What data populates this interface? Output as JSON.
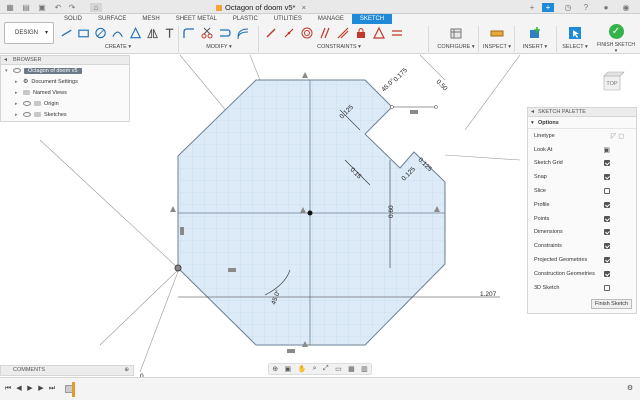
{
  "window": {
    "title": "Octagon of doom v5*"
  },
  "workspace": {
    "selector_label": "DESIGN",
    "tabs": [
      {
        "label": "SOLID"
      },
      {
        "label": "SURFACE"
      },
      {
        "label": "MESH"
      },
      {
        "label": "SHEET METAL"
      },
      {
        "label": "PLASTIC"
      },
      {
        "label": "UTILITIES"
      },
      {
        "label": "MANAGE"
      },
      {
        "label": "SKETCH",
        "active": true
      }
    ]
  },
  "toolbar_groups": {
    "create": "CREATE ▾",
    "modify": "MODIFY ▾",
    "constraints": "CONSTRAINTS ▾",
    "configure": "CONFIGURE ▾",
    "inspect": "INSPECT ▾",
    "insert": "INSERT ▾",
    "select": "SELECT ▾",
    "finish": "FINISH SKETCH ▾"
  },
  "browser": {
    "title": "BROWSER",
    "items": [
      {
        "label": "Octagon of doom v5"
      },
      {
        "label": "Document Settings"
      },
      {
        "label": "Named Views"
      },
      {
        "label": "Origin"
      },
      {
        "label": "Sketches"
      }
    ]
  },
  "sketch_palette": {
    "title": "SKETCH PALETTE",
    "section": "Options",
    "rows": [
      {
        "label": "Linetype"
      },
      {
        "label": "Look At"
      },
      {
        "label": "Sketch Grid",
        "checked": true
      },
      {
        "label": "Snap",
        "checked": true
      },
      {
        "label": "Slice",
        "checked": false
      },
      {
        "label": "Profile",
        "checked": true
      },
      {
        "label": "Points",
        "checked": true
      },
      {
        "label": "Dimensions",
        "checked": true
      },
      {
        "label": "Constraints",
        "checked": true
      },
      {
        "label": "Projected Geometries",
        "checked": true
      },
      {
        "label": "Construction Geometries",
        "checked": true
      },
      {
        "label": "3D Sketch",
        "checked": false
      }
    ],
    "finish_button": "Finish Sketch"
  },
  "viewcube": {
    "face": "TOP"
  },
  "comments": {
    "title": "COMMENTS"
  },
  "dimensions": {
    "d1": "0.175",
    "d2": "45.0°",
    "d3": "0.50",
    "d4": "0.125",
    "d5": "0.15",
    "d6": "0.125",
    "d7": "0.125",
    "d8": "0.60",
    "d9": "1.207",
    "d10": "45.0°",
    "d11": "0"
  },
  "colors": {
    "accent": "#1f8ad8",
    "profile_fill": "#dcebf7",
    "finish_green": "#35b24a"
  }
}
